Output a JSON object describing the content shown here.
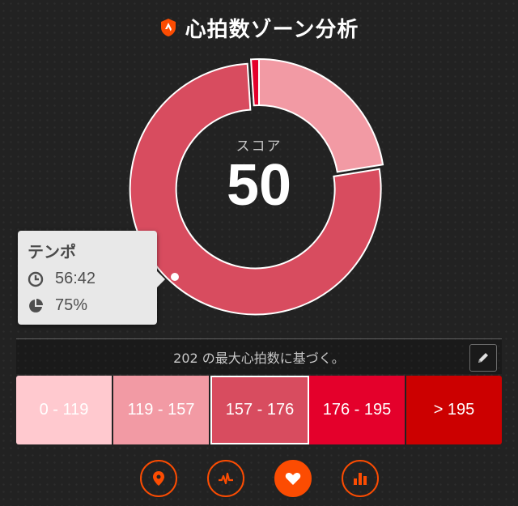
{
  "header": {
    "title": "心拍数ゾーン分析",
    "logo_icon": "strava-shield-icon"
  },
  "chart_data": {
    "type": "pie",
    "categories": [
      "0 - 119",
      "119 - 157",
      "157 - 176",
      "176 - 195",
      "> 195"
    ],
    "values": [
      0,
      22,
      75,
      1,
      0
    ],
    "colors": [
      "#ffc9cf",
      "#f29aa4",
      "#d84c5f",
      "#e4002b",
      "#cc0000"
    ],
    "highlighted": "157 - 176"
  },
  "score": {
    "label": "スコア",
    "value": "50"
  },
  "tooltip": {
    "title": "テンポ",
    "time": "56:42",
    "percent": "75%",
    "time_icon": "clock-icon",
    "percent_icon": "pie-icon"
  },
  "basis": {
    "text": "202 の最大心拍数に基づく。"
  },
  "zones": [
    {
      "label": "0 - 119",
      "color": "#ffc9cf",
      "text_color": "#ffffff"
    },
    {
      "label": "119 - 157",
      "color": "#f29aa4",
      "text_color": "#ffffff"
    },
    {
      "label": "157 - 176",
      "color": "#d84c5f",
      "text_color": "#ffffff"
    },
    {
      "label": "176 - 195",
      "color": "#e4002b",
      "text_color": "#ffffff"
    },
    {
      "label": "> 195",
      "color": "#cc0000",
      "text_color": "#ffffff"
    }
  ],
  "nav": [
    {
      "icon": "map-pin-icon",
      "active": false
    },
    {
      "icon": "activity-icon",
      "active": false
    },
    {
      "icon": "heart-icon",
      "active": true
    },
    {
      "icon": "bar-chart-icon",
      "active": false
    }
  ],
  "accent": "#fc4c02"
}
